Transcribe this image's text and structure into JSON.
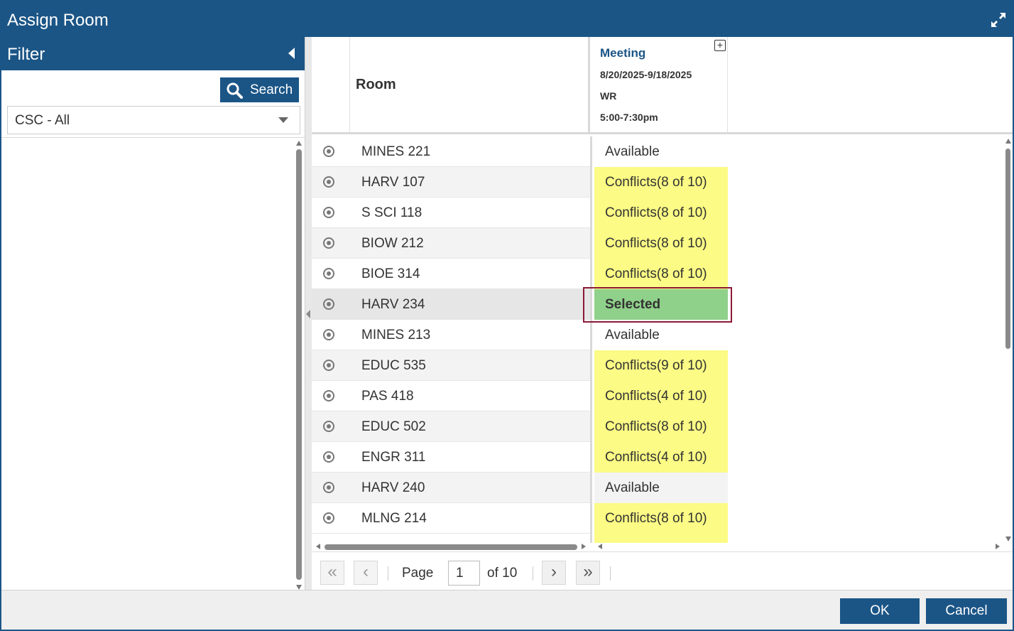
{
  "window": {
    "title": "Assign Room"
  },
  "filter": {
    "title": "Filter",
    "search_label": "Search",
    "select_value": "CSC - All"
  },
  "grid": {
    "room_header": "Room",
    "meeting": {
      "title": "Meeting",
      "dates": "8/20/2025-9/18/2025",
      "days": "WR",
      "time": "5:00-7:30pm"
    },
    "rows": [
      {
        "room": "MINES 221",
        "status": "Available"
      },
      {
        "room": "HARV 107",
        "status": "Conflicts(8 of 10)"
      },
      {
        "room": "S SCI 118",
        "status": "Conflicts(8 of 10)"
      },
      {
        "room": "BIOW 212",
        "status": "Conflicts(8 of 10)"
      },
      {
        "room": "BIOE 314",
        "status": "Conflicts(8 of 10)"
      },
      {
        "room": "HARV 234",
        "status": "Selected"
      },
      {
        "room": "MINES 213",
        "status": "Available"
      },
      {
        "room": "EDUC 535",
        "status": "Conflicts(9 of 10)"
      },
      {
        "room": "PAS 418",
        "status": "Conflicts(4 of 10)"
      },
      {
        "room": "EDUC 502",
        "status": "Conflicts(8 of 10)"
      },
      {
        "room": "ENGR 311",
        "status": "Conflicts(4 of 10)"
      },
      {
        "room": "HARV 240",
        "status": "Available"
      },
      {
        "room": "MLNG 214",
        "status": "Conflicts(8 of 10)"
      }
    ]
  },
  "pager": {
    "page_label": "Page",
    "page_value": "1",
    "of_label": "of 10"
  },
  "footer": {
    "ok_label": "OK",
    "cancel_label": "Cancel"
  },
  "colors": {
    "header_blue": "#1b5586",
    "conflict_yellow": "#fbfb85",
    "selected_green": "#8fd18a",
    "highlight_border": "#8b1a35"
  }
}
